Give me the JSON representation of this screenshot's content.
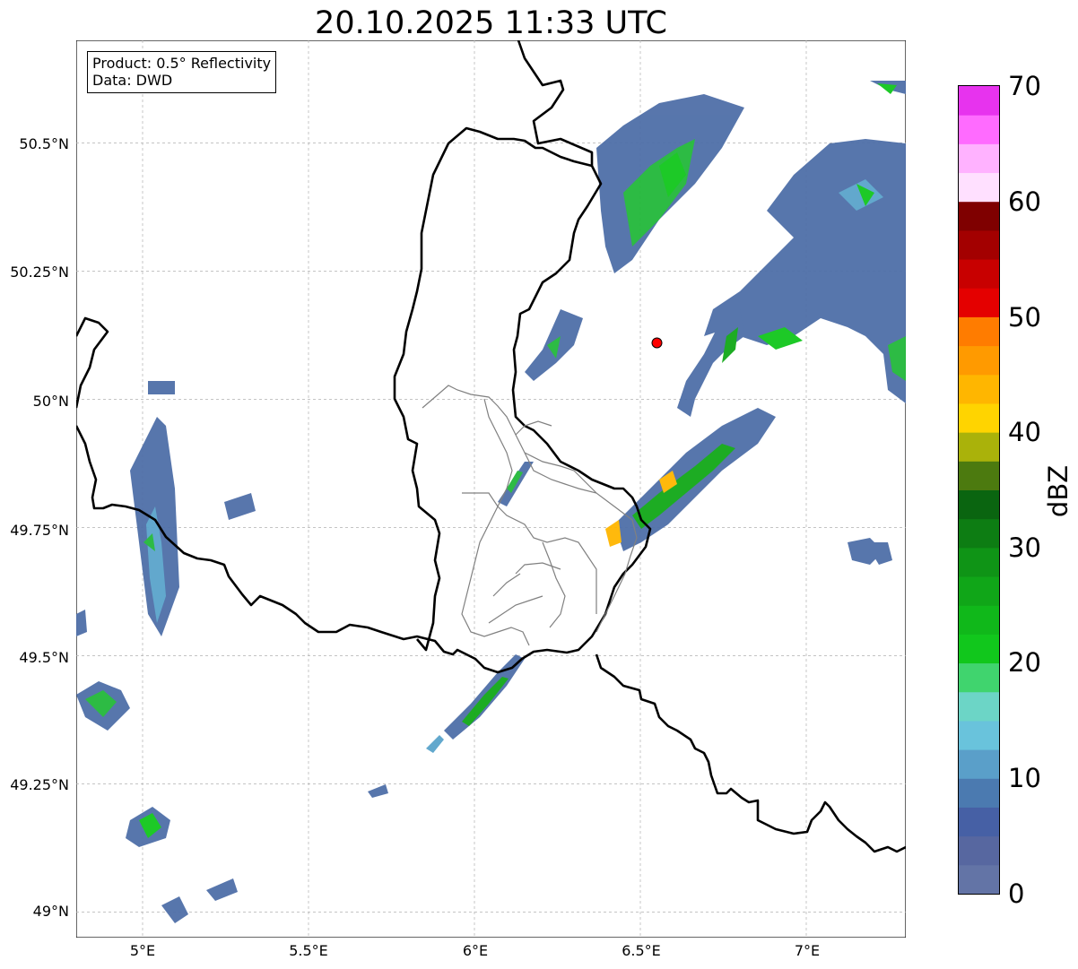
{
  "title": "20.10.2025 11:33 UTC",
  "legend": {
    "product": "Product: 0.5° Reflectivity",
    "data": "Data: DWD"
  },
  "axes": {
    "lat_ticks": [
      "50.5°N",
      "50.25°N",
      "50°N",
      "49.75°N",
      "49.5°N",
      "49.25°N",
      "49°N"
    ],
    "lon_ticks": [
      "5°E",
      "5.5°E",
      "6°E",
      "6.5°E",
      "7°E"
    ],
    "lat_range": [
      48.95,
      50.7
    ],
    "lon_range": [
      4.8,
      7.3
    ],
    "grid": true
  },
  "radar_site": {
    "lon": 6.55,
    "lat": 50.11,
    "color": "#ff0000"
  },
  "colorbar": {
    "label": "dBZ",
    "ticks": [
      "0",
      "10",
      "20",
      "30",
      "40",
      "50",
      "60",
      "70"
    ],
    "range": [
      0,
      70
    ],
    "colors": [
      "#6374a6",
      "#5767a0",
      "#4660a5",
      "#4b7ab0",
      "#5a9fc9",
      "#69c3dc",
      "#6cd5c6",
      "#40d46e",
      "#11c71c",
      "#10b81a",
      "#10a618",
      "#0f9416",
      "#0d7d13",
      "#0a6510",
      "#4c7a0f",
      "#aab20a",
      "#ffd400",
      "#ffb600",
      "#ff9a00",
      "#ff7c00",
      "#e40000",
      "#c80000",
      "#a30000",
      "#7f0000",
      "#ffe0ff",
      "#ffb2ff",
      "#ff6bff",
      "#e733ee"
    ]
  }
}
